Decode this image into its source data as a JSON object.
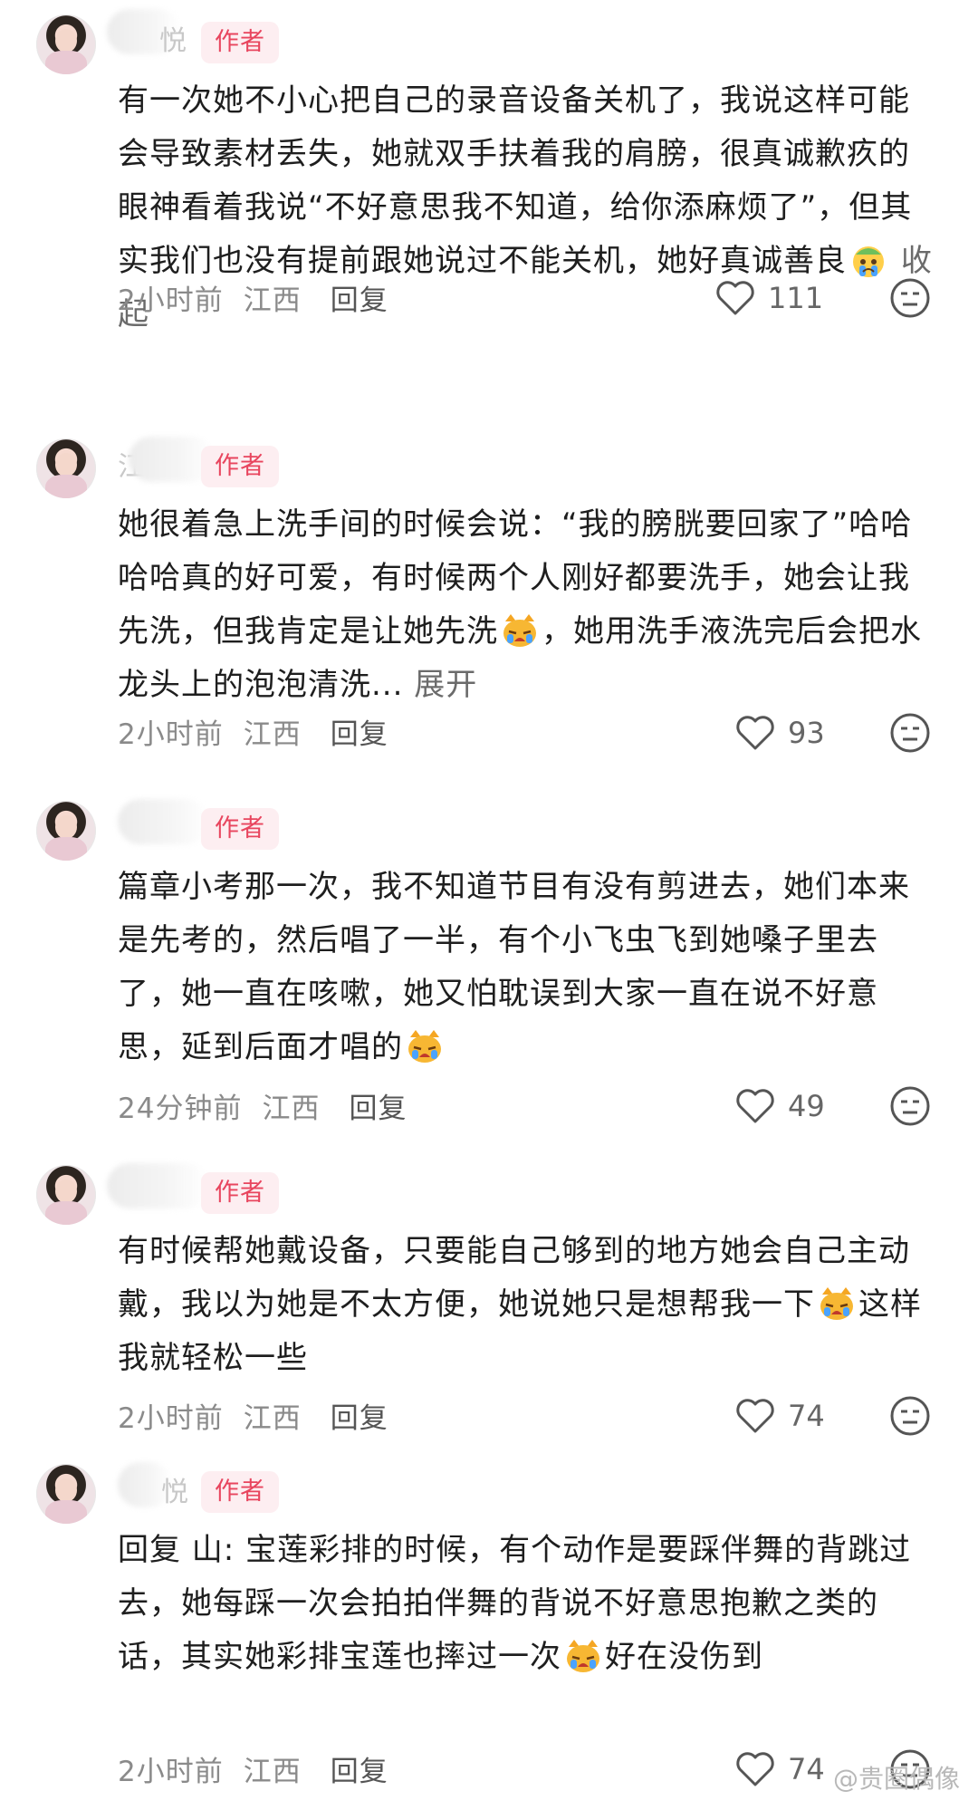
{
  "comments": [
    {
      "name_visible": "悦",
      "badge": "作者",
      "text_before_emoji": "有一次她不小心把自己的录音设备关机了，我说这样可能会导致素材丢失，她就双手扶着我的肩膀，很真诚歉疚的眼神看着我说“不好意思我不知道，给你添麻烦了”，但其实我们也没有提前跟她说过不能关机，她好真诚善良",
      "emoji": "crying-face-emoji",
      "text_after_emoji": "",
      "toggle_label": "收起",
      "time": "2小时前",
      "location": "江西",
      "reply_label": "回复",
      "likes": "111"
    },
    {
      "name_visible": "江",
      "badge": "作者",
      "text_before_emoji": "她很着急上洗手间的时候会说：“我的膀胱要回家了”哈哈哈哈真的好可爱，有时候两个人刚好都要洗手，她会让我先洗，但我肯定是让她先洗",
      "emoji": "crying-cat-emoji",
      "text_after_emoji": "，她用洗手液洗完后会把水龙头上的泡泡清洗...",
      "toggle_label": "展开",
      "time": "2小时前",
      "location": "江西",
      "reply_label": "回复",
      "likes": "93"
    },
    {
      "name_visible": "",
      "badge": "作者",
      "text_before_emoji": "篇章小考那一次，我不知道节目有没有剪进去，她们本来是先考的，然后唱了一半，有个小飞虫飞到她嗓子里去了，她一直在咳嗽，她又怕耽误到大家一直在说不好意思，延到后面才唱的",
      "emoji": "crying-cat-emoji",
      "text_after_emoji": "",
      "toggle_label": "",
      "time": "24分钟前",
      "location": "江西",
      "reply_label": "回复",
      "likes": "49"
    },
    {
      "name_visible": "",
      "badge": "作者",
      "text_before_emoji": "有时候帮她戴设备，只要能自己够到的地方她会自己主动戴，我以为她是不太方便，她说她只是想帮我一下",
      "emoji": "crying-cat-emoji",
      "text_after_emoji": "这样我就轻松一些",
      "toggle_label": "",
      "time": "2小时前",
      "location": "江西",
      "reply_label": "回复",
      "likes": "74"
    },
    {
      "name_visible": "悦",
      "badge": "作者",
      "text_before_emoji": "回复 山: 宝莲彩排的时候，有个动作是要踩伴舞的背跳过去，她每踩一次会拍拍伴舞的背说不好意思抱歉之类的话，其实她彩排宝莲也摔过一次",
      "emoji": "crying-cat-emoji",
      "text_after_emoji": "好在没伤到",
      "toggle_label": "",
      "time": "2小时前",
      "location": "江西",
      "reply_label": "回复",
      "likes": "74"
    }
  ],
  "watermark": "@贵圈偶像",
  "colors": {
    "badge_text": "#e8455e",
    "badge_bg": "#fdeef1",
    "meta_text": "#8a8a8a",
    "body_text": "#1e1e1e"
  }
}
